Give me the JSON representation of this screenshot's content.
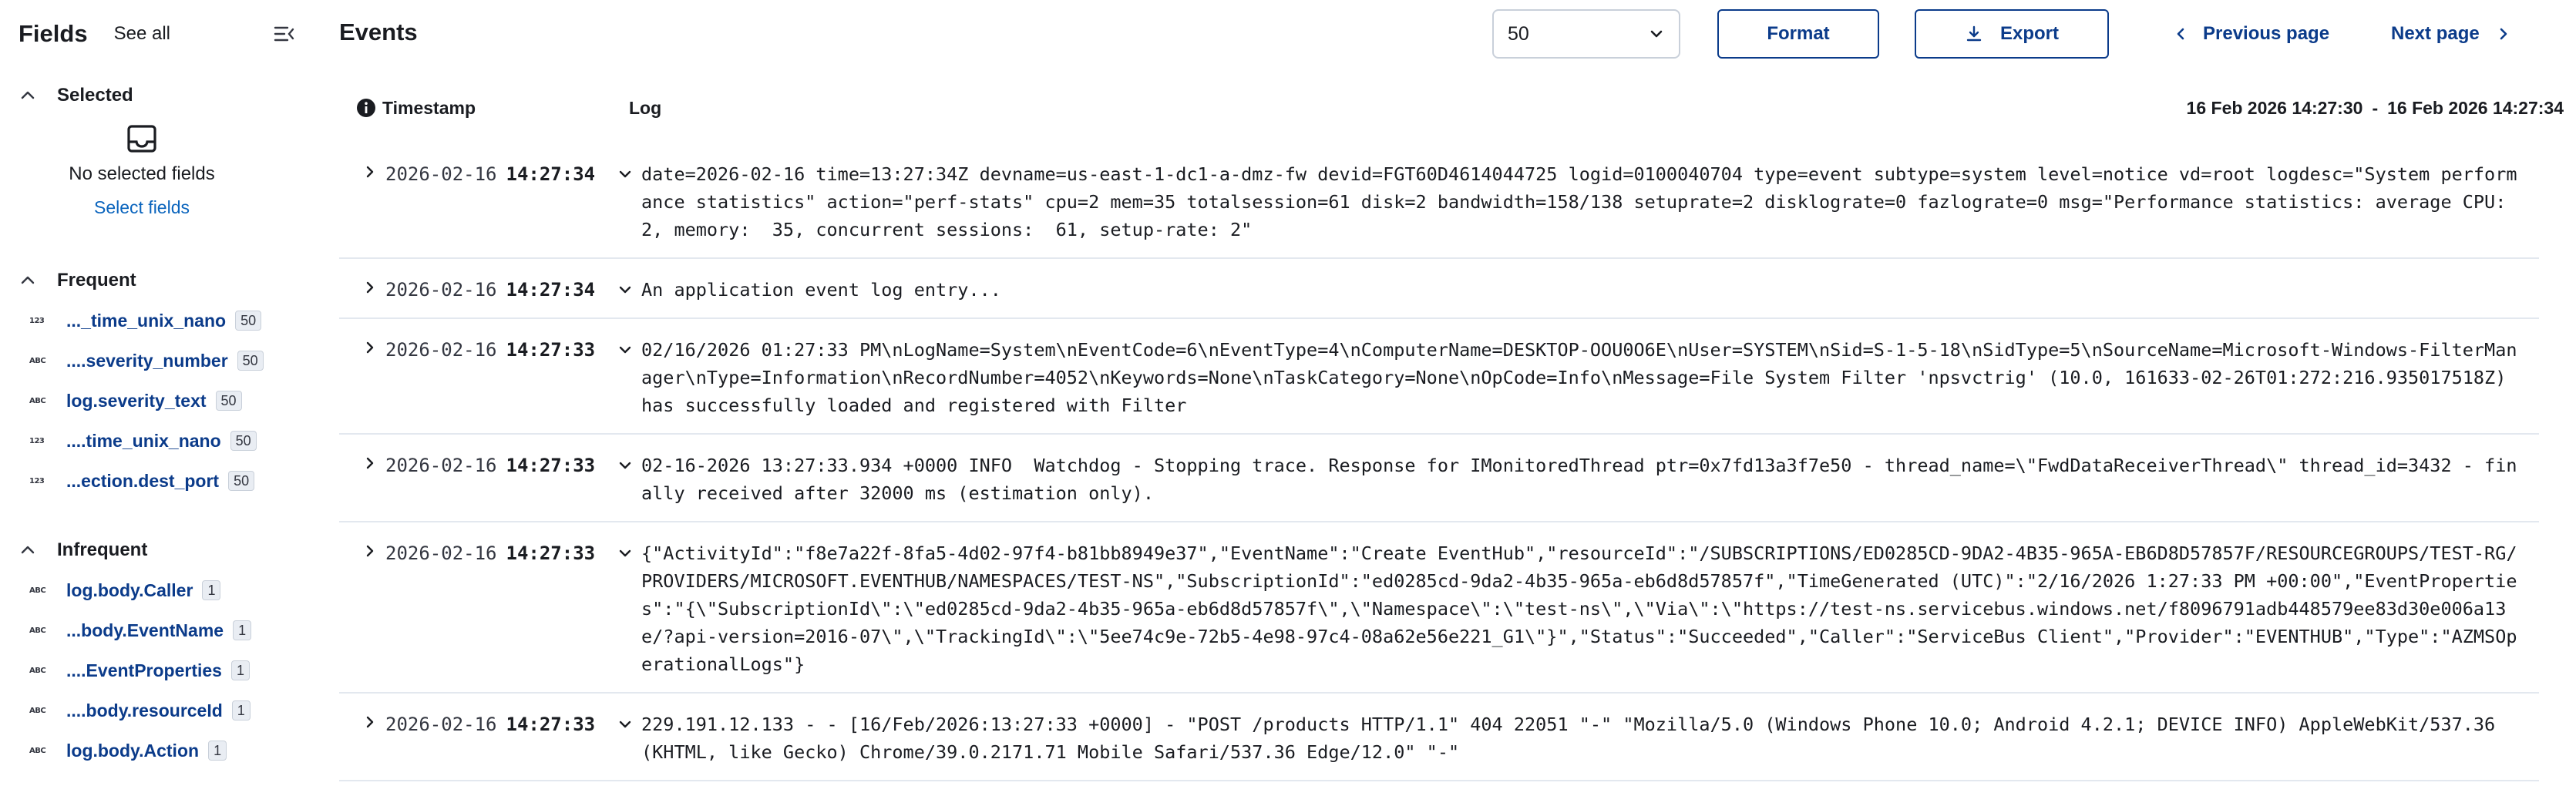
{
  "sidebar": {
    "title": "Fields",
    "see_all": "See all",
    "selected": {
      "title": "Selected",
      "empty_text": "No selected fields",
      "select_link": "Select fields"
    },
    "frequent": {
      "title": "Frequent",
      "fields": [
        {
          "type": "123",
          "name": "..._time_unix_nano",
          "count": "50"
        },
        {
          "type": "ABC",
          "name": "....severity_number",
          "count": "50"
        },
        {
          "type": "ABC",
          "name": "log.severity_text",
          "count": "50"
        },
        {
          "type": "123",
          "name": "....time_unix_nano",
          "count": "50"
        },
        {
          "type": "123",
          "name": "...ection.dest_port",
          "count": "50"
        }
      ]
    },
    "infrequent": {
      "title": "Infrequent",
      "fields": [
        {
          "type": "ABC",
          "name": "log.body.Caller",
          "count": "1"
        },
        {
          "type": "ABC",
          "name": "...body.EventName",
          "count": "1"
        },
        {
          "type": "ABC",
          "name": "....EventProperties",
          "count": "1"
        },
        {
          "type": "ABC",
          "name": "....body.resourceId",
          "count": "1"
        },
        {
          "type": "ABC",
          "name": "log.body.Action",
          "count": "1"
        }
      ]
    }
  },
  "main": {
    "title": "Events",
    "page_size": "50",
    "format_label": "Format",
    "export_label": "Export",
    "prev_label": "Previous page",
    "next_label": "Next page",
    "columns": {
      "timestamp": "Timestamp",
      "log": "Log",
      "range_start": "16 Feb 2026 14:27:30",
      "range_sep": "-",
      "range_end": "16 Feb 2026 14:27:34"
    },
    "rows": [
      {
        "date": "2026-02-16",
        "time": "14:27:34",
        "log": "date=2026-02-16 time=13:27:34Z devname=us-east-1-dc1-a-dmz-fw devid=FGT60D4614044725 logid=0100040704 type=event subtype=system level=notice vd=root logdesc=\"System performance statistics\" action=\"perf-stats\" cpu=2 mem=35 totalsession=61 disk=2 bandwidth=158/138 setuprate=2 disklograte=0 fazlograte=0 msg=\"Performance statistics: average CPU: 2, memory:  35, concurrent sessions:  61, setup-rate: 2\""
      },
      {
        "date": "2026-02-16",
        "time": "14:27:34",
        "log": "An application event log entry..."
      },
      {
        "date": "2026-02-16",
        "time": "14:27:33",
        "log": "02/16/2026 01:27:33 PM\\nLogName=System\\nEventCode=6\\nEventType=4\\nComputerName=DESKTOP-OOU0O6E\\nUser=SYSTEM\\nSid=S-1-5-18\\nSidType=5\\nSourceName=Microsoft-Windows-FilterManager\\nType=Information\\nRecordNumber=4052\\nKeywords=None\\nTaskCategory=None\\nOpCode=Info\\nMessage=File System Filter 'npsvctrig' (10.0, 161633-02-26T01:272:216.935017518Z) has successfully loaded and registered with Filter"
      },
      {
        "date": "2026-02-16",
        "time": "14:27:33",
        "log": "02-16-2026 13:27:33.934 +0000 INFO  Watchdog - Stopping trace. Response for IMonitoredThread ptr=0x7fd13a3f7e50 - thread_name=\\\"FwdDataReceiverThread\\\" thread_id=3432 - finally received after 32000 ms (estimation only)."
      },
      {
        "date": "2026-02-16",
        "time": "14:27:33",
        "log": "{\"ActivityId\":\"f8e7a22f-8fa5-4d02-97f4-b81bb8949e37\",\"EventName\":\"Create EventHub\",\"resourceId\":\"/SUBSCRIPTIONS/ED0285CD-9DA2-4B35-965A-EB6D8D57857F/RESOURCEGROUPS/TEST-RG/PROVIDERS/MICROSOFT.EVENTHUB/NAMESPACES/TEST-NS\",\"SubscriptionId\":\"ed0285cd-9da2-4b35-965a-eb6d8d57857f\",\"TimeGenerated (UTC)\":\"2/16/2026 1:27:33 PM +00:00\",\"EventProperties\":\"{\\\"SubscriptionId\\\":\\\"ed0285cd-9da2-4b35-965a-eb6d8d57857f\\\",\\\"Namespace\\\":\\\"test-ns\\\",\\\"Via\\\":\\\"https://test-ns.servicebus.windows.net/f8096791adb448579ee83d30e006a13e/?api-version=2016-07\\\",\\\"TrackingId\\\":\\\"5ee74c9e-72b5-4e98-97c4-08a62e56e221_G1\\\"}\",\"Status\":\"Succeeded\",\"Caller\":\"ServiceBus Client\",\"Provider\":\"EVENTHUB\",\"Type\":\"AZMSOperationalLogs\"}"
      },
      {
        "date": "2026-02-16",
        "time": "14:27:33",
        "log": "229.191.12.133 - - [16/Feb/2026:13:27:33 +0000] - \"POST /products HTTP/1.1\" 404 22051 \"-\" \"Mozilla/5.0 (Windows Phone 10.0; Android 4.2.1; DEVICE INFO) AppleWebKit/537.36 (KHTML, like Gecko) Chrome/39.0.2171.71 Mobile Safari/537.36 Edge/12.0\" \"-\""
      }
    ]
  }
}
